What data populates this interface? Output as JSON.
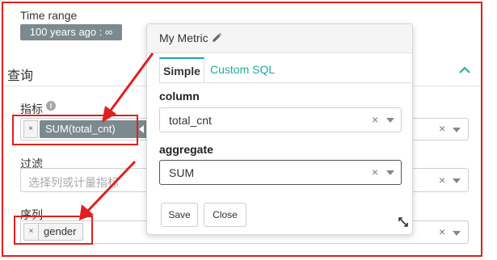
{
  "time_range": {
    "label": "Time range",
    "value": "100 years ago : ∞"
  },
  "query": {
    "title": "查询",
    "collapse_icon": "chevron-up-icon"
  },
  "metric": {
    "label": "指标",
    "info_icon": "i",
    "tag_value": "SUM(total_cnt)",
    "clear": "×"
  },
  "filter": {
    "label": "过滤",
    "placeholder": "选择列或计量指标",
    "clear": "×"
  },
  "series": {
    "label": "序列",
    "tag_value": "gender",
    "clear": "×"
  },
  "popover": {
    "title": "My Metric",
    "tabs": [
      {
        "label": "Simple",
        "active": true
      },
      {
        "label": "Custom SQL",
        "active": false
      }
    ],
    "column": {
      "label": "column",
      "value": "total_cnt",
      "clear": "×"
    },
    "aggregate": {
      "label": "aggregate",
      "value": "SUM",
      "clear": "×"
    },
    "save_label": "Save",
    "close_label": "Close"
  },
  "colors": {
    "accent": "#20a7a1",
    "annotation": "#e02020",
    "badge": "#7b8a8f"
  }
}
